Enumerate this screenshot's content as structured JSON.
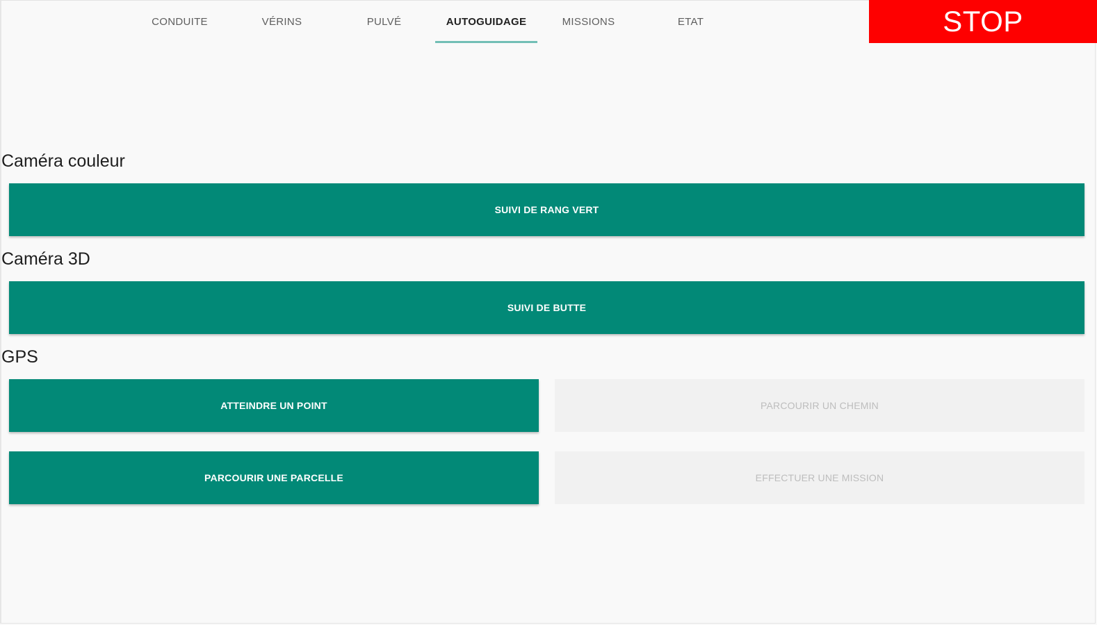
{
  "tabs": [
    {
      "label": "CONDUITE"
    },
    {
      "label": "VÉRINS"
    },
    {
      "label": "PULVÉ"
    },
    {
      "label": "AUTOGUIDAGE",
      "active": true
    },
    {
      "label": "MISSIONS"
    },
    {
      "label": "ETAT"
    }
  ],
  "stop_label": "STOP",
  "sections": {
    "camera_couleur": {
      "label": "Caméra couleur",
      "buttons": {
        "suivi_rang_vert": "SUIVI DE RANG VERT"
      }
    },
    "camera_3d": {
      "label": "Caméra 3D",
      "buttons": {
        "suivi_butte": "SUIVI DE BUTTE"
      }
    },
    "gps": {
      "label": "GPS",
      "buttons": {
        "atteindre_point": "ATTEINDRE UN POINT",
        "parcourir_chemin": "PARCOURIR UN CHEMIN",
        "parcourir_parcelle": "PARCOURIR UNE PARCELLE",
        "effectuer_mission": "EFFECTUER UNE MISSION"
      }
    }
  },
  "colors": {
    "primary_button": "#028977",
    "stop_button": "#fe0000",
    "active_tab_indicator": "#72bfb5",
    "disabled_button": "#f1f1f1"
  }
}
